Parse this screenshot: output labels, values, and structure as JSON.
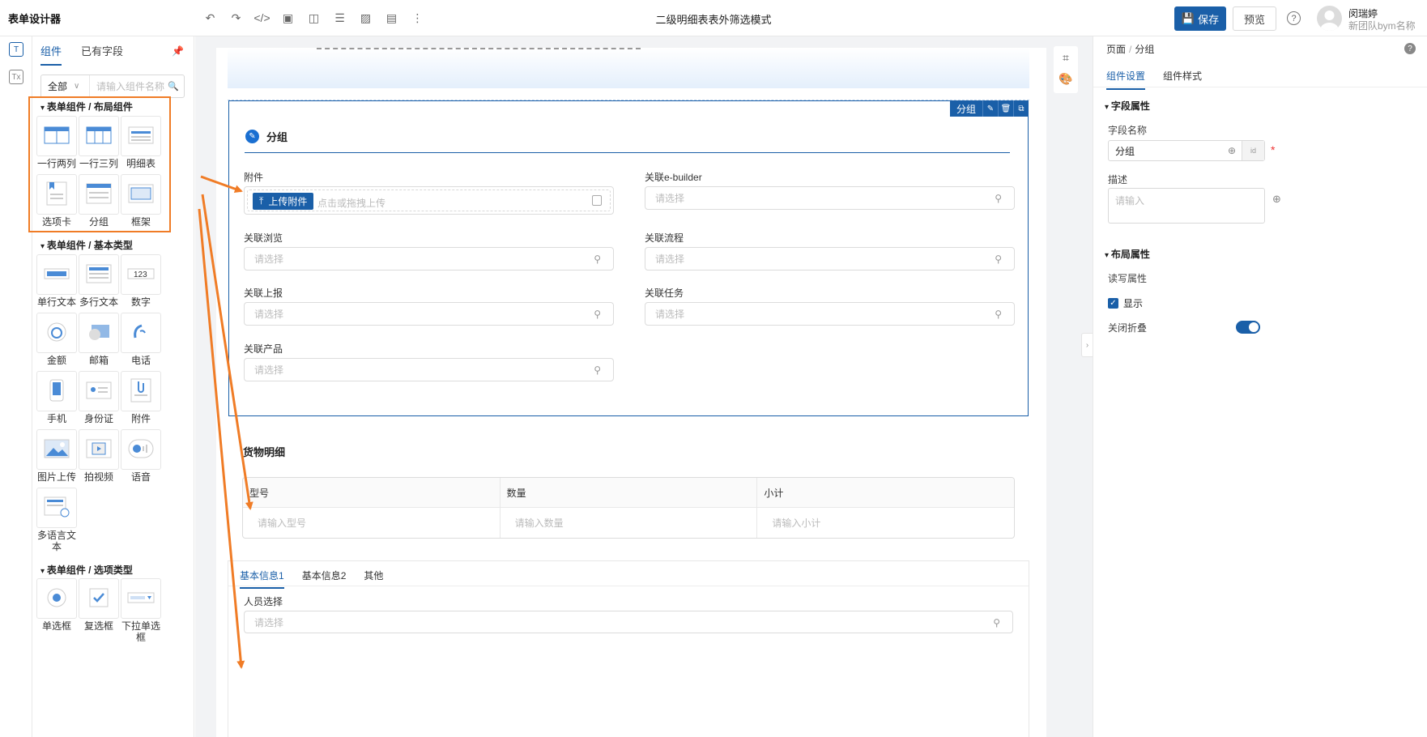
{
  "app": {
    "title": "表单设计器",
    "document_title": "二级明细表表外筛选模式",
    "save_label": "保存",
    "preview_label": "预览",
    "help_label": "?",
    "user": {
      "name": "闵瑞婷",
      "team": "新团队bym名称"
    },
    "toolbar_icons": [
      "undo-icon",
      "redo-icon",
      "code-icon",
      "image-icon",
      "layout-icon",
      "database-icon",
      "chart-icon",
      "document-icon",
      "more-icon"
    ]
  },
  "left_rail": {
    "items": [
      "T",
      "Tx"
    ]
  },
  "component_panel": {
    "tabs": [
      "组件",
      "已有字段"
    ],
    "active_tab": 0,
    "filter": {
      "selected": "全部",
      "placeholder": "请输入组件名称"
    },
    "sections": [
      {
        "title": "表单组件 / 布局组件",
        "items": [
          "一行两列",
          "一行三列",
          "明细表",
          "选项卡",
          "分组",
          "框架"
        ]
      },
      {
        "title": "表单组件 / 基本类型",
        "items": [
          "单行文本",
          "多行文本",
          "数字",
          "金额",
          "邮箱",
          "电话",
          "手机",
          "身份证",
          "附件",
          "图片上传",
          "拍视频",
          "语音",
          "多语言文本"
        ]
      },
      {
        "title": "表单组件 / 选项类型",
        "items": [
          "单选框",
          "复选框",
          "下拉单选框"
        ]
      }
    ],
    "number_tile_text": "123",
    "highlight_color": "#f07c26"
  },
  "canvas": {
    "group": {
      "title": "分组",
      "toolbar_label": "分组",
      "fields": {
        "attachment": {
          "label": "附件",
          "button": "上传附件",
          "hint": "点击或拖拽上传"
        },
        "ebuilder": {
          "label": "关联e-builder",
          "placeholder": "请选择"
        },
        "browse": {
          "label": "关联浏览",
          "placeholder": "请选择"
        },
        "workflow": {
          "label": "关联流程",
          "placeholder": "请选择"
        },
        "report": {
          "label": "关联上报",
          "placeholder": "请选择"
        },
        "task": {
          "label": "关联任务",
          "placeholder": "请选择"
        },
        "product": {
          "label": "关联产品",
          "placeholder": "请选择"
        }
      }
    },
    "detail": {
      "title": "货物明细",
      "columns": [
        "型号",
        "数量",
        "小计"
      ],
      "placeholders": [
        "请输入型号",
        "请输入数量",
        "请输入小计"
      ]
    },
    "tabs_block": {
      "tabs": [
        "基本信息1",
        "基本信息2",
        "其他"
      ],
      "active_tab": 0,
      "field": {
        "label": "人员选择",
        "placeholder": "请选择"
      }
    }
  },
  "properties": {
    "breadcrumb": [
      "页面",
      "分组"
    ],
    "tabs": [
      "组件设置",
      "组件样式"
    ],
    "active_tab": 0,
    "field_section": "字段属性",
    "field_name_label": "字段名称",
    "field_name_value": "分组",
    "description_label": "描述",
    "description_placeholder": "请输入",
    "layout_section": "布局属性",
    "rw_label": "读写属性",
    "show_label": "显示",
    "show_checked": true,
    "collapse_label": "关闭折叠",
    "collapse_on": true
  },
  "colors": {
    "primary": "#1a5fa8",
    "accent_arrow": "#f07c26",
    "canvas_bg": "#f2f3f5"
  }
}
